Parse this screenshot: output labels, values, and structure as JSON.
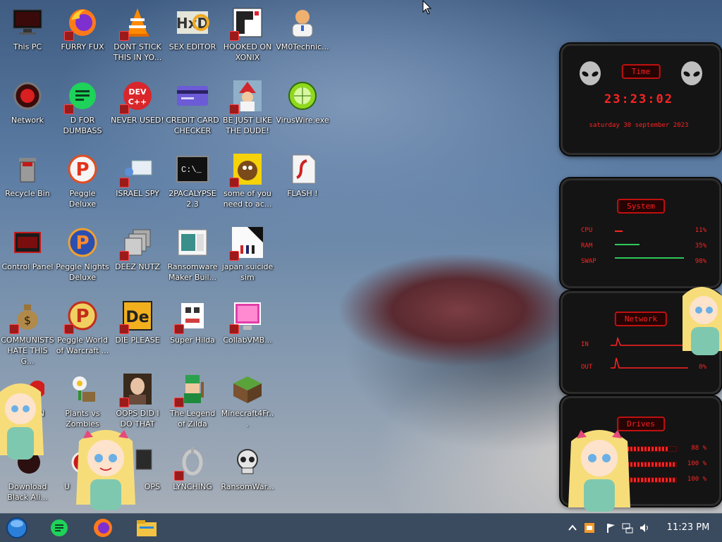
{
  "desktop": {
    "icons": [
      {
        "label": "This PC"
      },
      {
        "label": "FURRY FUX"
      },
      {
        "label": "DONT STICK THIS IN YO..."
      },
      {
        "label": "SEX EDITOR"
      },
      {
        "label": "HOOKED ON XONIX"
      },
      {
        "label": "VM0Technic..."
      },
      {
        "label": "Network"
      },
      {
        "label": "D FOR DUMBASS"
      },
      {
        "label": "NEVER USED!"
      },
      {
        "label": "CREDIT CARD CHECKER"
      },
      {
        "label": "BE JUST LIKE THE DUDE!"
      },
      {
        "label": "VirusWire.exe"
      },
      {
        "label": "Recycle Bin"
      },
      {
        "label": "Peggle Deluxe"
      },
      {
        "label": "ISRAEL SPY"
      },
      {
        "label": "2PACALYPSE 2.3"
      },
      {
        "label": "some of you need to ac..."
      },
      {
        "label": "FLASH !"
      },
      {
        "label": "Control Panel"
      },
      {
        "label": "Peggle Nights Deluxe"
      },
      {
        "label": "DEEZ NUTZ"
      },
      {
        "label": "Ransomware Maker Buil..."
      },
      {
        "label": "japan suicide sim"
      },
      {
        "label": "COMMUNISTS HATE THIS G..."
      },
      {
        "label": "Peggle World of Warcraft ..."
      },
      {
        "label": "DIE PLEASE"
      },
      {
        "label": "Super Hilda"
      },
      {
        "label": "CollabVMB..."
      },
      {
        "label": "N"
      },
      {
        "label": "Plants vs Zombies"
      },
      {
        "label": "OOPS DID I DO THAT"
      },
      {
        "label": "The Legend of Zilda"
      },
      {
        "label": "Minecraft4Fr..."
      },
      {
        "label": "Download Black Ali..."
      },
      {
        "label": "U"
      },
      {
        "label": "OPS"
      },
      {
        "label": "LYNCHING"
      },
      {
        "label": "RansomWar..."
      }
    ]
  },
  "gadgets": {
    "time": {
      "title": "Time",
      "clock": "23:23:02",
      "date": "saturday 30 september 2023"
    },
    "system": {
      "title": "System",
      "rows": [
        {
          "label": "CPU",
          "value": "11%",
          "level": 0.11
        },
        {
          "label": "RAM",
          "value": "35%",
          "level": 0.35
        },
        {
          "label": "SWAP",
          "value": "98%",
          "level": 0.98
        }
      ]
    },
    "network": {
      "title": "Network",
      "rows": [
        {
          "label": "IN",
          "value": ""
        },
        {
          "label": "OUT",
          "value": "0%"
        }
      ]
    },
    "drives": {
      "title": "Drives",
      "rows": [
        {
          "value": "88 %",
          "level": 0.88
        },
        {
          "value": "100 %",
          "level": 1.0
        },
        {
          "value": "100 %",
          "level": 1.0
        }
      ]
    }
  },
  "taskbar": {
    "clock": "11:23 PM",
    "pinned": [
      "start-orb",
      "green-app",
      "firefox",
      "file-explorer"
    ],
    "tray": [
      "show-hidden-icons",
      "tray-app",
      "action-center-flag",
      "network",
      "volume"
    ]
  },
  "colors": {
    "gadget_red": "#ff2323",
    "taskbar": "#3a4a5f"
  }
}
